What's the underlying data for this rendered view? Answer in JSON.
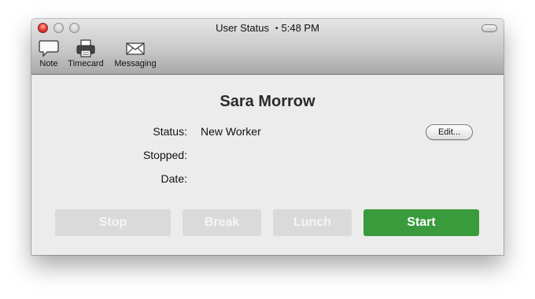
{
  "window": {
    "title": "User Status",
    "time": "5:48 PM",
    "separator": "•"
  },
  "toolbar": {
    "items": [
      {
        "label": "Note",
        "icon": "speech-bubble-icon"
      },
      {
        "label": "Timecard",
        "icon": "printer-icon"
      },
      {
        "label": "Messaging",
        "icon": "envelope-icon"
      }
    ]
  },
  "user": {
    "name": "Sara Morrow"
  },
  "fields": {
    "status_label": "Status:",
    "status_value": "New Worker",
    "stopped_label": "Stopped:",
    "stopped_value": "",
    "date_label": "Date:",
    "date_value": ""
  },
  "edit_button": {
    "label": "Edit..."
  },
  "actions": [
    {
      "label": "Stop",
      "enabled": false
    },
    {
      "label": "Break",
      "enabled": false
    },
    {
      "label": "Lunch",
      "enabled": false
    },
    {
      "label": "Start",
      "enabled": true
    }
  ],
  "colors": {
    "start_button": "#399b3b",
    "disabled_button": "#dadada",
    "close_light": "#e2362d"
  }
}
